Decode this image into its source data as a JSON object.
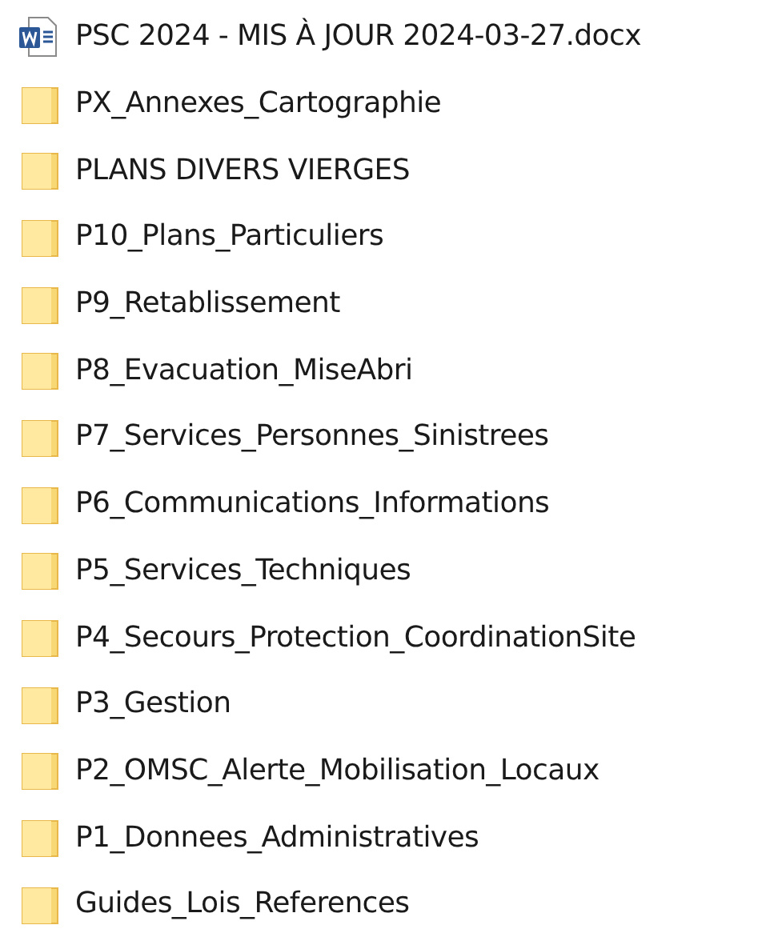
{
  "files": [
    {
      "kind": "word-document",
      "name": "PSC 2024 - MIS À JOUR 2024-03-27.docx"
    },
    {
      "kind": "folder",
      "name": "PX_Annexes_Cartographie"
    },
    {
      "kind": "folder",
      "name": "PLANS DIVERS VIERGES"
    },
    {
      "kind": "folder",
      "name": "P10_Plans_Particuliers"
    },
    {
      "kind": "folder",
      "name": "P9_Retablissement"
    },
    {
      "kind": "folder",
      "name": "P8_Evacuation_MiseAbri"
    },
    {
      "kind": "folder",
      "name": "P7_Services_Personnes_Sinistrees"
    },
    {
      "kind": "folder",
      "name": "P6_Communications_Informations"
    },
    {
      "kind": "folder",
      "name": "P5_Services_Techniques"
    },
    {
      "kind": "folder",
      "name": "P4_Secours_Protection_CoordinationSite"
    },
    {
      "kind": "folder",
      "name": "P3_Gestion"
    },
    {
      "kind": "folder",
      "name": "P2_OMSC_Alerte_Mobilisation_Locaux"
    },
    {
      "kind": "folder",
      "name": "P1_Donnees_Administratives"
    },
    {
      "kind": "folder",
      "name": "Guides_Lois_References"
    }
  ]
}
